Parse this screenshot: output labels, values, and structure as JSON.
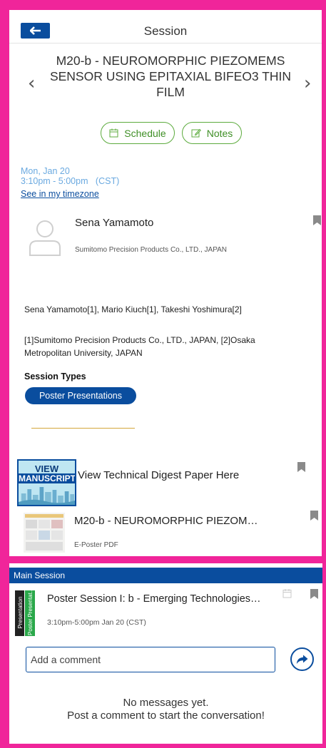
{
  "header": {
    "title": "Session"
  },
  "session": {
    "title_lines": [
      "M20-b - NEUROMORPHIC PIEZOMEMS",
      "SENSOR USING EPITAXIAL BIFEO3 THIN",
      "FILM"
    ],
    "date": "Mon, Jan 20",
    "time": "3:10pm - 5:00pm   (CST)",
    "timezone_link": "See in my timezone"
  },
  "actions": {
    "schedule": "Schedule",
    "notes": "Notes"
  },
  "speaker": {
    "name": "Sena Yamamoto",
    "affiliation": "Sumitomo Precision Products Co., LTD., JAPAN"
  },
  "authors": "Sena Yamamoto[1], Mario Kiuch[1], Takeshi Yoshimura[2]",
  "affiliations": "[1]Sumitomo Precision Products Co., LTD., JAPAN, [2]Osaka Metropolitan University, JAPAN",
  "session_types": {
    "heading": "Session Types",
    "badge": "Poster Presentations"
  },
  "attachments": {
    "manuscript": {
      "thumb_line1": "VIEW",
      "thumb_line2": "MANUSCRIPT",
      "label": "View Technical Digest Paper Here"
    },
    "poster": {
      "title": "M20-b - NEUROMORPHIC PIEZOM…",
      "type": "E-Poster PDF"
    }
  },
  "main_session": {
    "bar_label": "Main Session",
    "tag_a": "Presentation",
    "tag_b": "Poster Presentat...",
    "title": "Poster Session I: b - Emerging Technologies…",
    "time": "3:10pm-5:00pm Jan 20 (CST)"
  },
  "comments": {
    "placeholder": "Add a comment",
    "empty_line1": "No messages yet.",
    "empty_line2": "Post a comment to start the conversation!"
  },
  "colors": {
    "frame": "#f0259a",
    "primary": "#0a4d9e",
    "green": "#5cab3d",
    "date_text": "#6aa9e0"
  }
}
